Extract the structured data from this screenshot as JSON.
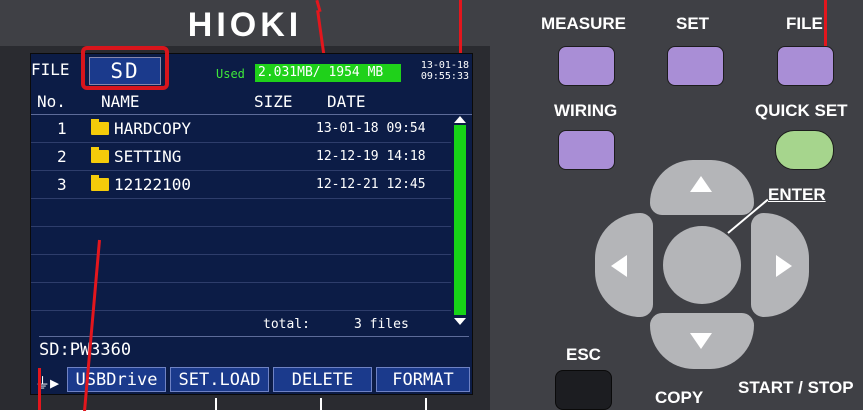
{
  "device": {
    "brand": "HIOKI"
  },
  "screen": {
    "header": {
      "file_label": "FILE",
      "tab": "SD",
      "used_label": "Used",
      "used_value": "2.031MB/ 1954 MB",
      "clock_line1": "13-01-18",
      "clock_line2": "09:55:33"
    },
    "columns": {
      "no": "No.",
      "name": "NAME",
      "size": "SIZE",
      "date": "DATE"
    },
    "rows": [
      {
        "no": "1",
        "name": "HARDCOPY",
        "date": "13-01-18 09:54"
      },
      {
        "no": "2",
        "name": "SETTING",
        "date": "12-12-19 14:18"
      },
      {
        "no": "3",
        "name": "12122100",
        "date": "12-12-21 12:45"
      }
    ],
    "total_label": "total:",
    "total_value": "3 files",
    "path": "SD:PW3360",
    "fkeys": [
      "USBDrive",
      "SET.LOAD",
      "DELETE",
      "FORMAT"
    ]
  },
  "buttons": {
    "measure": "MEASURE",
    "set": "SET",
    "file": "FILE",
    "wiring": "WIRING",
    "quick_set": "QUICK SET",
    "enter": "ENTER",
    "esc": "ESC",
    "copy": "COPY",
    "start_stop": "START / STOP"
  },
  "colors": {
    "screen_bg": "#0c1c46",
    "highlight": "#d8151c",
    "used_bar": "#1fd11a",
    "folder": "#f4cb0a",
    "purple_button": "#a98ed6",
    "green_button": "#a6d58d"
  }
}
